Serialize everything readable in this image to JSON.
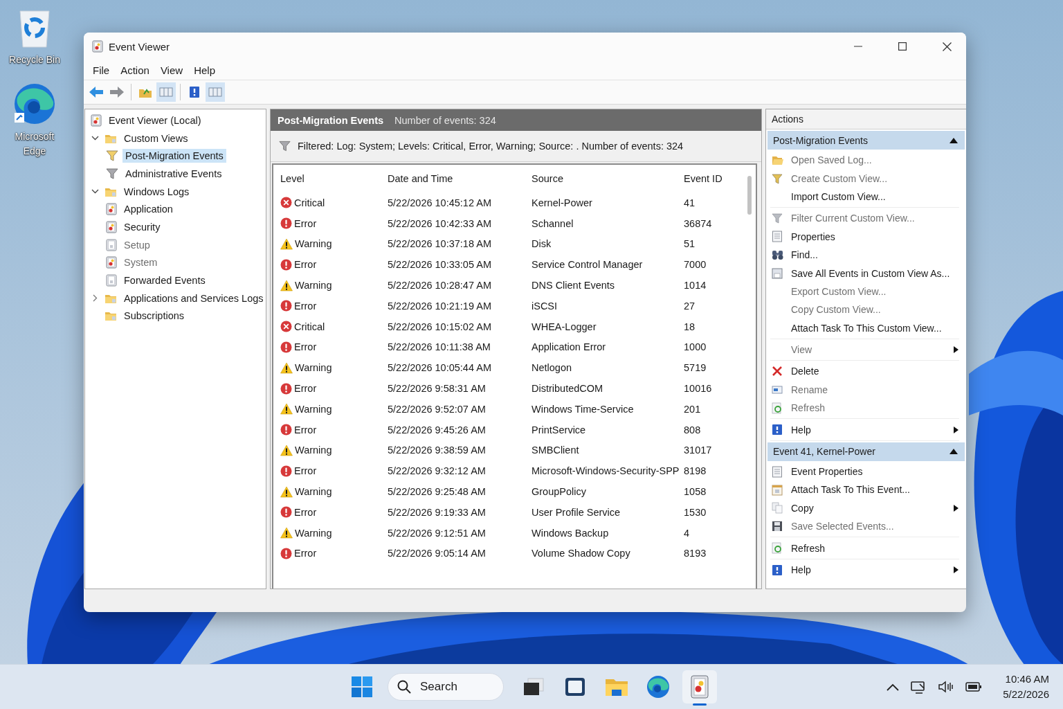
{
  "desktop_icons": [
    {
      "label": "Recycle Bin",
      "kind": "recycle"
    },
    {
      "label": "Microsoft Edge",
      "kind": "edge"
    }
  ],
  "window": {
    "title": "Event Viewer",
    "menu": [
      "File",
      "Action",
      "View",
      "Help"
    ],
    "toolbar": [
      [
        {
          "kind": "back",
          "on": false
        },
        {
          "kind": "forward",
          "on": false
        }
      ],
      [
        {
          "kind": "up-folder",
          "on": false
        },
        {
          "kind": "panel",
          "on": true
        }
      ],
      [
        {
          "kind": "help",
          "on": false
        },
        {
          "kind": "panel",
          "on": true
        }
      ]
    ]
  },
  "tree": [
    {
      "label": "Event Viewer (Local)",
      "kind": "log",
      "selected": false,
      "disabled": false,
      "children": [
        {
          "label": "Custom Views",
          "kind": "folder",
          "expanded": true,
          "selected": false,
          "disabled": false,
          "children": [
            {
              "label": "Post-Migration Events",
              "kind": "filter",
              "selected": true,
              "disabled": false
            },
            {
              "label": "Administrative Events",
              "kind": "filter-grey",
              "selected": false,
              "disabled": false
            }
          ]
        },
        {
          "label": "Windows Logs",
          "kind": "folder",
          "expanded": true,
          "selected": false,
          "disabled": false,
          "children": [
            {
              "label": "Application",
              "kind": "log",
              "selected": false,
              "disabled": false
            },
            {
              "label": "Security",
              "kind": "log",
              "selected": false,
              "disabled": false
            },
            {
              "label": "Setup",
              "kind": "log-plain",
              "selected": false,
              "disabled": true
            },
            {
              "label": "System",
              "kind": "log",
              "selected": false,
              "disabled": true
            },
            {
              "label": "Forwarded Events",
              "kind": "log-plain",
              "selected": false,
              "disabled": false
            }
          ]
        },
        {
          "label": "Applications and Services Logs",
          "kind": "folder",
          "expanded": false,
          "selected": false,
          "disabled": false
        },
        {
          "label": "Subscriptions",
          "kind": "folder",
          "selected": false,
          "disabled": false
        }
      ]
    }
  ],
  "events": {
    "title": "Post-Migration Events",
    "count": "Number of events: 324",
    "filter": "Filtered: Log: System; Levels: Critical, Error, Warning; Source: . Number of events: 324",
    "columns": [
      "Level",
      "Date and Time",
      "Source",
      "Event ID"
    ],
    "rows": [
      {
        "kind": "critical",
        "severity": "Critical",
        "date": "5/22/2026 10:45:12 AM",
        "source": "Kernel-Power",
        "id": "41"
      },
      {
        "kind": "error",
        "severity": "Error",
        "date": "5/22/2026 10:42:33 AM",
        "source": "Schannel",
        "id": "36874"
      },
      {
        "kind": "warning",
        "severity": "Warning",
        "date": "5/22/2026 10:37:18 AM",
        "source": "Disk",
        "id": "51"
      },
      {
        "kind": "error",
        "severity": "Error",
        "date": "5/22/2026 10:33:05 AM",
        "source": "Service Control Manager",
        "id": "7000"
      },
      {
        "kind": "warning",
        "severity": "Warning",
        "date": "5/22/2026 10:28:47 AM",
        "source": "DNS Client Events",
        "id": "1014"
      },
      {
        "kind": "error",
        "severity": "Error",
        "date": "5/22/2026 10:21:19 AM",
        "source": "iSCSI",
        "id": "27"
      },
      {
        "kind": "critical",
        "severity": "Critical",
        "date": "5/22/2026 10:15:02 AM",
        "source": "WHEA-Logger",
        "id": "18"
      },
      {
        "kind": "error",
        "severity": "Error",
        "date": "5/22/2026 10:11:38 AM",
        "source": "Application Error",
        "id": "1000"
      },
      {
        "kind": "warning",
        "severity": "Warning",
        "date": "5/22/2026 10:05:44 AM",
        "source": "Netlogon",
        "id": "5719"
      },
      {
        "kind": "error",
        "severity": "Error",
        "date": "5/22/2026 9:58:31 AM",
        "source": "DistributedCOM",
        "id": "10016"
      },
      {
        "kind": "warning",
        "severity": "Warning",
        "date": "5/22/2026 9:52:07 AM",
        "source": "Windows Time-Service",
        "id": "201"
      },
      {
        "kind": "error",
        "severity": "Error",
        "date": "5/22/2026 9:45:26 AM",
        "source": "PrintService",
        "id": "808"
      },
      {
        "kind": "warning",
        "severity": "Warning",
        "date": "5/22/2026 9:38:59 AM",
        "source": "SMBClient",
        "id": "31017"
      },
      {
        "kind": "error",
        "severity": "Error",
        "date": "5/22/2026 9:32:12 AM",
        "source": "Microsoft-Windows-Security-SPP",
        "id": "8198"
      },
      {
        "kind": "warning",
        "severity": "Warning",
        "date": "5/22/2026 9:25:48 AM",
        "source": "GroupPolicy",
        "id": "1058"
      },
      {
        "kind": "error",
        "severity": "Error",
        "date": "5/22/2026 9:19:33 AM",
        "source": "User Profile Service",
        "id": "1530"
      },
      {
        "kind": "warning",
        "severity": "Warning",
        "date": "5/22/2026 9:12:51 AM",
        "source": "Windows Backup",
        "id": "4"
      },
      {
        "kind": "error",
        "severity": "Error",
        "date": "5/22/2026 9:05:14 AM",
        "source": "Volume Shadow Copy",
        "id": "8193"
      }
    ]
  },
  "actions": {
    "title": "Actions",
    "sections": [
      {
        "title": "Post-Migration Events",
        "expanded": true,
        "groups": [
          [
            {
              "label": "Open Saved Log...",
              "kind": "open-log",
              "disabled": true,
              "submenu": false
            },
            {
              "label": "Create Custom View...",
              "kind": "funnel",
              "disabled": true,
              "submenu": false
            },
            {
              "label": "Import Custom View...",
              "disabled": false,
              "submenu": false
            }
          ],
          [
            {
              "label": "Filter Current Custom View...",
              "kind": "funnel-grey",
              "disabled": true,
              "submenu": false
            },
            {
              "label": "Properties",
              "kind": "properties",
              "disabled": false,
              "submenu": false
            },
            {
              "label": "Find...",
              "kind": "find",
              "disabled": false,
              "submenu": false
            },
            {
              "label": "Save All Events in Custom View As...",
              "kind": "save-as",
              "disabled": false,
              "submenu": false
            },
            {
              "label": "Export Custom View...",
              "disabled": true,
              "submenu": false
            },
            {
              "label": "Copy Custom View...",
              "disabled": true,
              "submenu": false
            },
            {
              "label": "Attach Task To This Custom View...",
              "disabled": false,
              "submenu": false
            }
          ],
          [
            {
              "label": "View",
              "disabled": true,
              "submenu": true
            }
          ],
          [
            {
              "label": "Delete",
              "kind": "delete",
              "disabled": false,
              "submenu": false
            },
            {
              "label": "Rename",
              "kind": "rename",
              "disabled": true,
              "submenu": false
            },
            {
              "label": "Refresh",
              "kind": "refresh",
              "disabled": true,
              "submenu": false
            }
          ],
          [
            {
              "label": "Help",
              "kind": "help",
              "disabled": false,
              "submenu": true
            }
          ]
        ]
      },
      {
        "title": "Event 41, Kernel-Power",
        "expanded": true,
        "groups": [
          [
            {
              "label": "Event Properties",
              "kind": "properties",
              "disabled": false,
              "submenu": false
            },
            {
              "label": "Attach Task To This Event...",
              "kind": "attach",
              "disabled": false,
              "submenu": false
            },
            {
              "label": "Copy",
              "kind": "copy",
              "disabled": false,
              "submenu": true
            },
            {
              "label": "Save Selected Events...",
              "kind": "save",
              "disabled": true,
              "submenu": false
            }
          ],
          [
            {
              "label": "Refresh",
              "kind": "refresh",
              "disabled": false,
              "submenu": false
            }
          ],
          [
            {
              "label": "Help",
              "kind": "help",
              "disabled": false,
              "submenu": true
            }
          ]
        ]
      }
    ]
  },
  "taskbar": {
    "search": {
      "placeholder": "Search"
    },
    "apps": [
      {
        "kind": "task-view",
        "active": false
      },
      {
        "kind": "window-app",
        "active": false
      },
      {
        "kind": "explorer",
        "active": false
      },
      {
        "kind": "edge",
        "active": false
      },
      {
        "kind": "event-viewer",
        "active": true
      }
    ],
    "time": "10:46 AM",
    "date": "5/22/2026"
  }
}
